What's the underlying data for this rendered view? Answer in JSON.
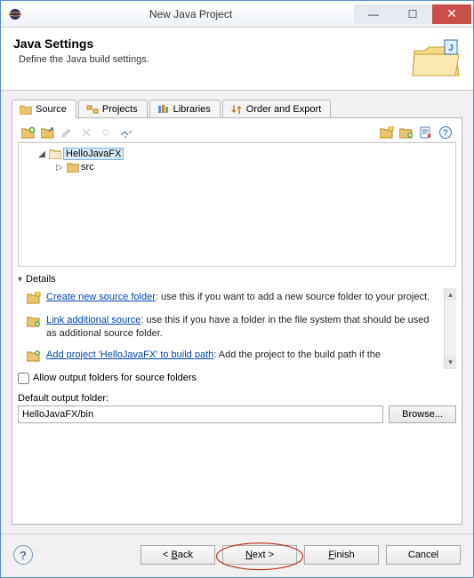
{
  "window": {
    "title": "New Java Project"
  },
  "banner": {
    "heading": "Java Settings",
    "subheading": "Define the Java build settings."
  },
  "tabs": {
    "source": "Source",
    "projects": "Projects",
    "libraries": "Libraries",
    "order": "Order and Export"
  },
  "tree": {
    "project": "HelloJavaFX",
    "src": "src"
  },
  "details": {
    "heading": "Details",
    "create": {
      "link": "Create new source folder",
      "text": ": use this if you want to add a new source folder to your project."
    },
    "link": {
      "link": "Link additional source",
      "text": ": use this if you have a folder in the file system that should be used as additional source folder."
    },
    "add": {
      "link": "Add project 'HelloJavaFX' to build path",
      "text": ": Add the project to the build path if the"
    }
  },
  "allow_output_label": "Allow output folders for source folders",
  "default_output_label": "Default output folder:",
  "default_output_value": "HelloJavaFX/bin",
  "browse": "Browse...",
  "footer": {
    "back": "< Back",
    "next": "Next >",
    "finish": "Finish",
    "cancel": "Cancel"
  }
}
